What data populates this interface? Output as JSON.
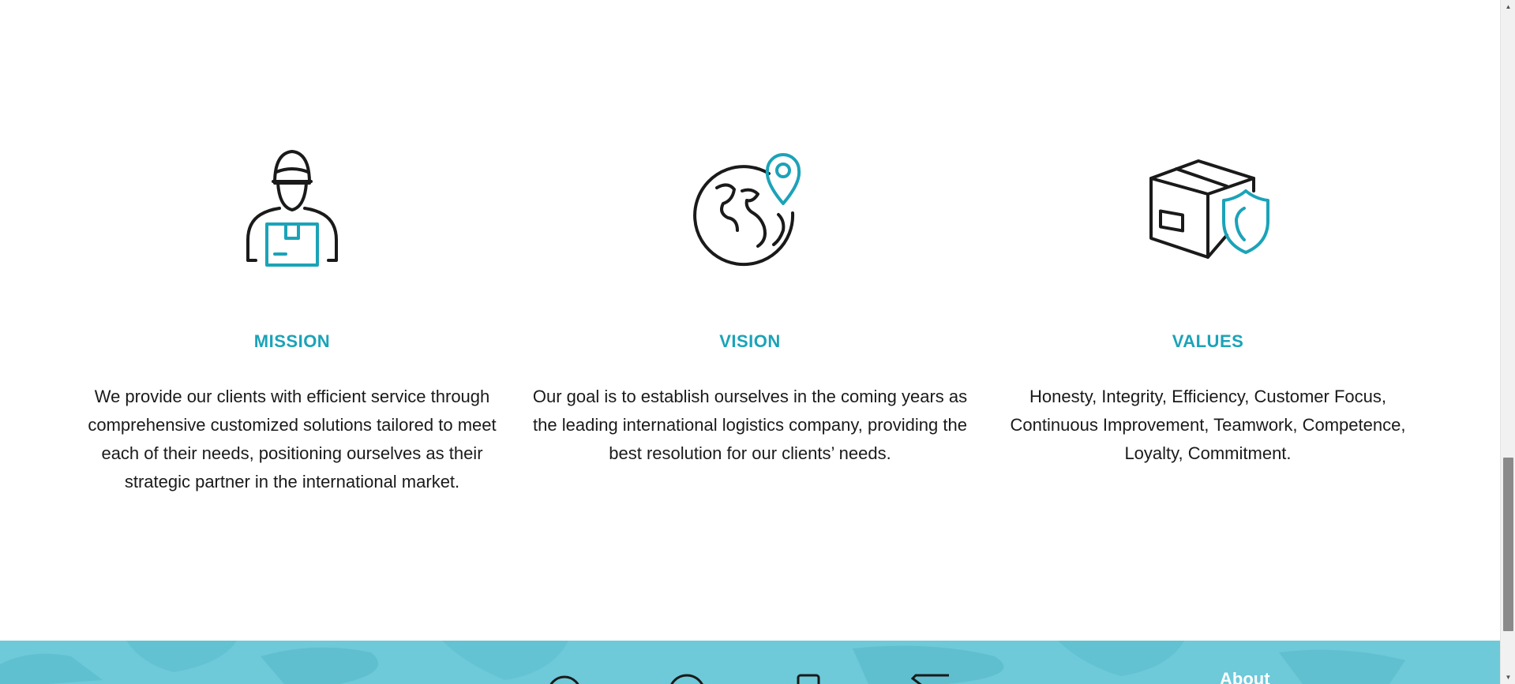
{
  "colors": {
    "accent": "#1ba3b8",
    "footer": "#6ec9d8",
    "text": "#1a1a1a"
  },
  "sections": [
    {
      "icon": "delivery-person-icon",
      "title": "MISSION",
      "text": "We provide our clients with efficient service through comprehensive customized solutions tailored to meet each of their needs, positioning ourselves as their strategic partner in the international market."
    },
    {
      "icon": "globe-location-pin-icon",
      "title": "VISION",
      "text": "Our goal is to establish ourselves in the coming years as the leading international logistics company, providing the best resolution for our clients’ needs."
    },
    {
      "icon": "box-shield-icon",
      "title": "VALUES",
      "text": "Honesty, Integrity, Efficiency, Customer Focus, Continuous Improvement, Teamwork, Competence, Loyalty, Commitment."
    }
  ],
  "footer": {
    "about_label": "About",
    "icons": [
      "location-icon",
      "clock-icon",
      "phone-icon",
      "mail-icon"
    ]
  }
}
